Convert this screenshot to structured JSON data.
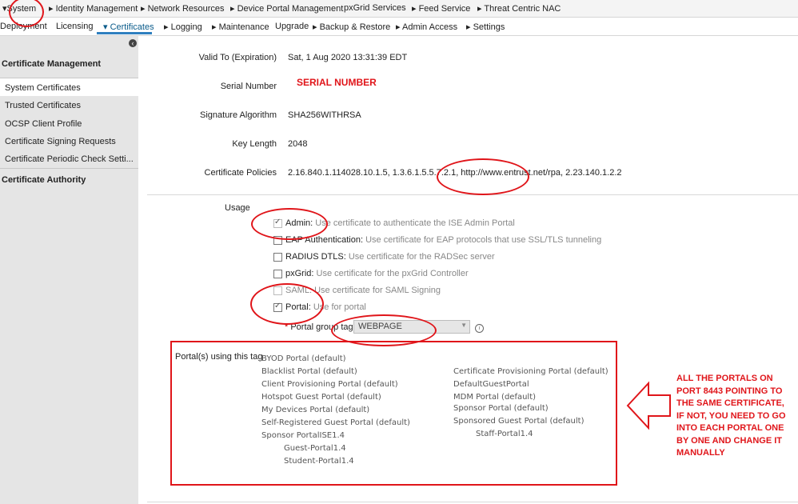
{
  "top_nav": [
    {
      "label": "System",
      "active": true,
      "caret": true
    },
    {
      "label": "Identity Management",
      "caret": true
    },
    {
      "label": "Network Resources",
      "caret": true
    },
    {
      "label": "Device Portal Management",
      "caret": true
    },
    {
      "label": "pxGrid Services",
      "caret": false
    },
    {
      "label": "Feed Service",
      "caret": true
    },
    {
      "label": "Threat Centric NAC",
      "caret": true
    }
  ],
  "sub_nav": [
    {
      "label": "Deployment"
    },
    {
      "label": "Licensing"
    },
    {
      "label": "Certificates",
      "active": true,
      "caret": true
    },
    {
      "label": "Logging",
      "caret": true
    },
    {
      "label": "Maintenance",
      "caret": true
    },
    {
      "label": "Upgrade"
    },
    {
      "label": "Backup & Restore",
      "caret": true
    },
    {
      "label": "Admin Access",
      "caret": true
    },
    {
      "label": "Settings",
      "caret": true
    }
  ],
  "sidebar": {
    "section1": "Certificate Management",
    "items": [
      "System Certificates",
      "Trusted Certificates",
      "OCSP Client Profile",
      "Certificate Signing Requests",
      "Certificate Periodic Check Setti..."
    ],
    "section2": "Certificate Authority",
    "selected": "System Certificates"
  },
  "details": {
    "valid_to_label": "Valid To (Expiration)",
    "valid_to": "Sat, 1 Aug 2020 13:31:39 EDT",
    "serial_label": "Serial Number",
    "serial_value": "SERIAL NUMBER",
    "sig_label": "Signature Algorithm",
    "sig_value": "SHA256WITHRSA",
    "key_label": "Key Length",
    "key_value": "2048",
    "policies_label": "Certificate Policies",
    "policies_value": "2.16.840.1.114028.10.1.5, 1.3.6.1.5.5.7.2.1, http://www.entrust.net/rpa, 2.23.140.1.2.2"
  },
  "usage": {
    "label": "Usage",
    "options": [
      {
        "name": "Admin:",
        "desc": " Use certificate to authenticate the ISE Admin Portal",
        "checked": true,
        "disabled": true
      },
      {
        "name": "EAP Authentication:",
        "desc": " Use certificate for EAP protocols that use SSL/TLS tunneling",
        "checked": false
      },
      {
        "name": "RADIUS DTLS:",
        "desc": " Use certificate for the RADSec server",
        "checked": false
      },
      {
        "name": "pxGrid:",
        "desc": " Use certificate for the pxGrid Controller",
        "checked": false
      },
      {
        "name": "SAML:",
        "desc": " Use certificate for SAML Signing",
        "checked": false,
        "disabled": true
      },
      {
        "name": "Portal:",
        "desc": " Use for portal",
        "checked": true
      }
    ],
    "portal_group_star": "*",
    "portal_group_label": " Portal group tag",
    "portal_group_value": "WEBPAGE"
  },
  "portals": {
    "label": "Portal(s) using this tag",
    "col1": [
      "BYOD Portal (default)",
      "Blacklist Portal (default)",
      "Client Provisioning Portal (default)",
      "Hotspot Guest Portal (default)",
      "My Devices Portal (default)",
      "Self-Registered Guest Portal (default)",
      "Sponsor PortalISE1.4"
    ],
    "col1_indented": [
      "Guest-Portal1.4",
      "Student-Portal1.4"
    ],
    "col2": [
      "Certificate Provisioning Portal (default)",
      "DefaultGuestPortal",
      "MDM Portal (default)",
      "Sponsor Portal (default)",
      "Sponsored Guest Portal (default)"
    ],
    "col2_indented": [
      "Staff-Portal1.4"
    ]
  },
  "annotation": {
    "note": "ALL THE PORTALS ON PORT 8443 POINTING TO THE SAME CERTIFICATE, IF NOT, YOU NEED TO GO INTO EACH PORTAL ONE BY ONE AND CHANGE IT MANUALLY",
    "color": "#e0151a"
  }
}
